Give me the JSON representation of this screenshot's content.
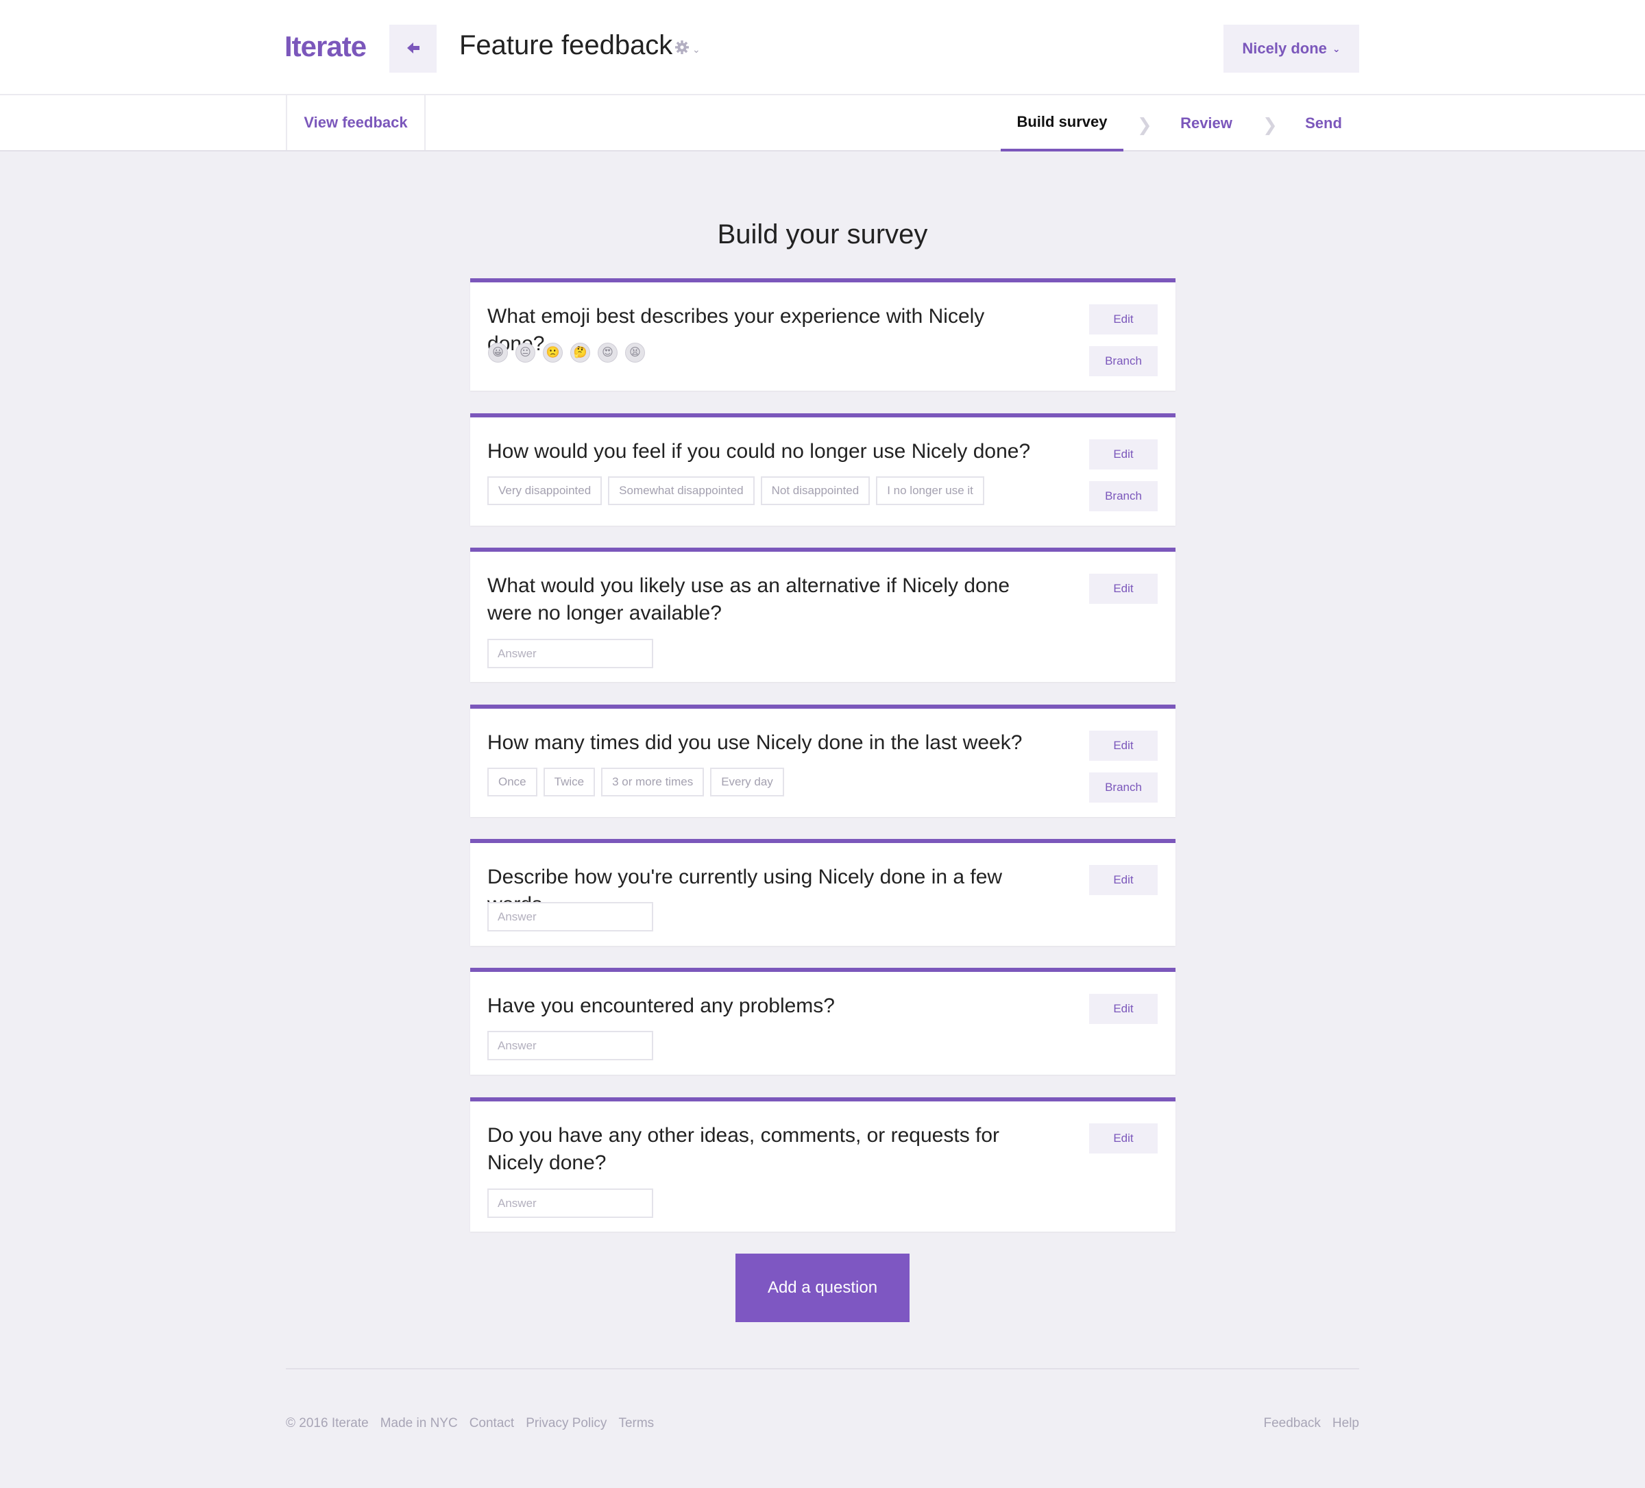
{
  "header": {
    "logo": "Iterate",
    "title": "Feature feedback",
    "account_label": "Nicely done"
  },
  "nav": {
    "view_feedback": "View feedback",
    "steps": [
      "Build survey",
      "Review",
      "Send"
    ],
    "active_step": "Build survey"
  },
  "main": {
    "title": "Build your survey",
    "edit_label": "Edit",
    "branch_label": "Branch",
    "answer_placeholder": "Answer",
    "questions": [
      {
        "text": "What emoji best describes your experience with Nicely done?",
        "type": "emoji",
        "emojis": [
          "😀",
          "😐",
          "🙁",
          "🤔",
          "😍",
          "😫"
        ]
      },
      {
        "text": "How would you feel if you could no longer use Nicely done?",
        "type": "choice",
        "choices": [
          "Very disappointed",
          "Somewhat disappointed",
          "Not disappointed",
          "I no longer use it"
        ]
      },
      {
        "text": "What would you likely use as an alternative if Nicely done were no longer available?",
        "type": "text"
      },
      {
        "text": "How many times did you use Nicely done in the last week?",
        "type": "choice",
        "choices": [
          "Once",
          "Twice",
          "3 or more times",
          "Every day"
        ]
      },
      {
        "text": "Describe how you're currently using Nicely done in a few words.",
        "type": "text"
      },
      {
        "text": "Have you encountered any problems?",
        "type": "text"
      },
      {
        "text": "Do you have any other ideas, comments, or requests for Nicely done?",
        "type": "text"
      }
    ],
    "add_question_label": "Add a question"
  },
  "footer": {
    "left": [
      "© 2016 Iterate",
      "Made in NYC",
      "Contact",
      "Privacy Policy",
      "Terms"
    ],
    "right": [
      "Feedback",
      "Help"
    ]
  },
  "colors": {
    "accent": "#7b57bb",
    "background": "#f0eff4"
  }
}
